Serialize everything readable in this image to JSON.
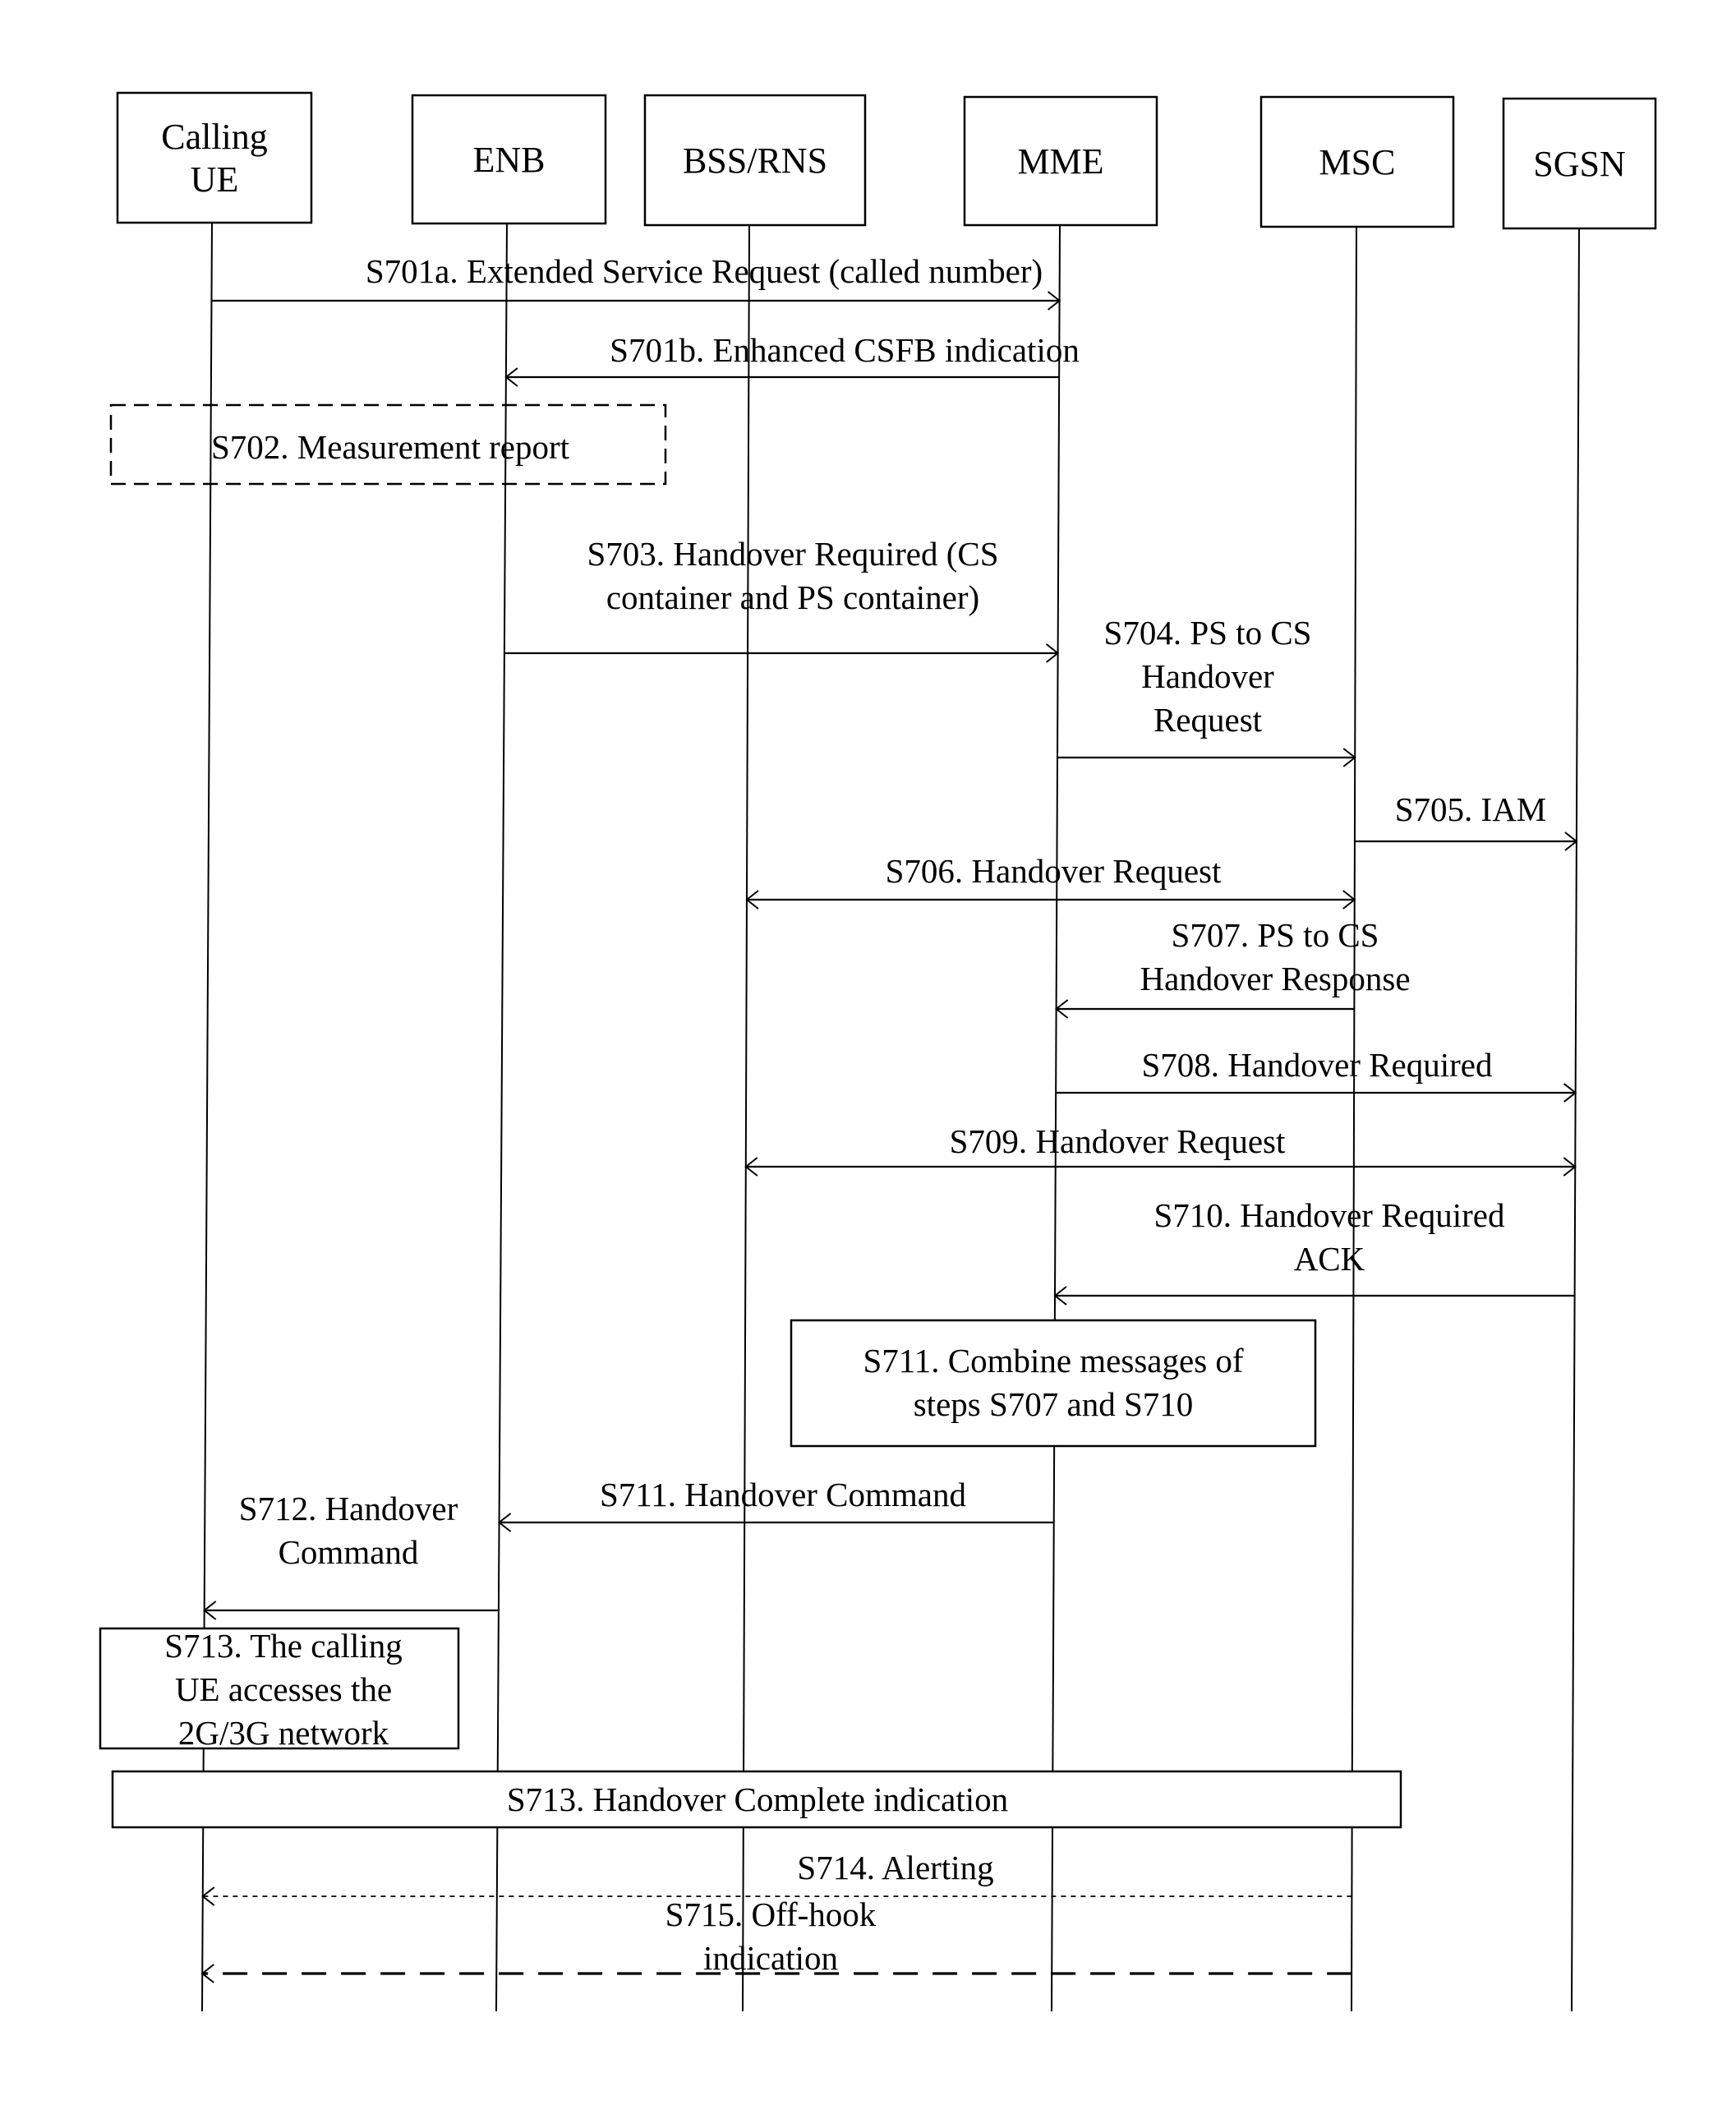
{
  "diagram": {
    "type": "sequence",
    "participants": [
      {
        "id": "ue",
        "lines": [
          "Calling",
          "UE"
        ]
      },
      {
        "id": "enb",
        "lines": [
          "ENB"
        ]
      },
      {
        "id": "bss",
        "lines": [
          "BSS/RNS"
        ]
      },
      {
        "id": "mme",
        "lines": [
          "MME"
        ]
      },
      {
        "id": "msc",
        "lines": [
          "MSC"
        ]
      },
      {
        "id": "sgsn",
        "lines": [
          "SGSN"
        ]
      }
    ],
    "messages": [
      {
        "id": "s701a",
        "from": "ue",
        "to": "mme",
        "style": "solid",
        "lines": [
          "S701a. Extended Service Request (called number)"
        ]
      },
      {
        "id": "s701b",
        "from": "mme",
        "to": "enb",
        "style": "solid",
        "lines": [
          "S701b. Enhanced CSFB indication"
        ]
      },
      {
        "id": "s703",
        "from": "enb",
        "to": "mme",
        "style": "solid",
        "lines": [
          "S703. Handover Required (CS",
          "container and PS container)"
        ]
      },
      {
        "id": "s704",
        "from": "mme",
        "to": "msc",
        "style": "solid",
        "lines": [
          "S704. PS to CS",
          "Handover",
          "Request"
        ]
      },
      {
        "id": "s705",
        "from": "msc",
        "to": "sgsn",
        "style": "solid",
        "lines": [
          "S705. IAM"
        ]
      },
      {
        "id": "s706",
        "from": "msc",
        "to": "bss",
        "style": "solid",
        "bidirectional": true,
        "lines": [
          "S706. Handover Request"
        ]
      },
      {
        "id": "s707",
        "from": "msc",
        "to": "mme",
        "style": "solid",
        "lines": [
          "S707. PS to CS",
          "Handover Response"
        ]
      },
      {
        "id": "s708",
        "from": "mme",
        "to": "sgsn",
        "style": "solid",
        "lines": [
          "S708. Handover Required"
        ]
      },
      {
        "id": "s709",
        "from": "sgsn",
        "to": "bss",
        "style": "solid",
        "bidirectional": true,
        "lines": [
          "S709. Handover Request"
        ]
      },
      {
        "id": "s710",
        "from": "sgsn",
        "to": "mme",
        "style": "solid",
        "lines": [
          "S710. Handover Required",
          "ACK"
        ]
      },
      {
        "id": "s711cmd",
        "from": "mme",
        "to": "enb",
        "style": "solid",
        "lines": [
          "S711. Handover Command"
        ]
      },
      {
        "id": "s712",
        "from": "enb",
        "to": "ue",
        "style": "solid",
        "lines": [
          "S712. Handover",
          "Command"
        ]
      },
      {
        "id": "s714",
        "from": "msc",
        "to": "ue",
        "style": "dotted",
        "lines": [
          "S714. Alerting"
        ]
      },
      {
        "id": "s715",
        "from": "msc",
        "to": "ue",
        "style": "dashed",
        "lines": [
          "S715. Off-hook",
          "indication"
        ]
      }
    ],
    "notes": [
      {
        "id": "s702",
        "style": "dashed",
        "lines": [
          "S702. Measurement report"
        ]
      },
      {
        "id": "s711",
        "style": "solid",
        "lines": [
          "S711. Combine messages of",
          "steps S707 and S710"
        ]
      },
      {
        "id": "s713a",
        "style": "solid",
        "lines": [
          "S713. The calling",
          "UE accesses the",
          "2G/3G network"
        ]
      },
      {
        "id": "s713b",
        "style": "solid",
        "lines": [
          "S713. Handover Complete indication"
        ]
      }
    ]
  }
}
